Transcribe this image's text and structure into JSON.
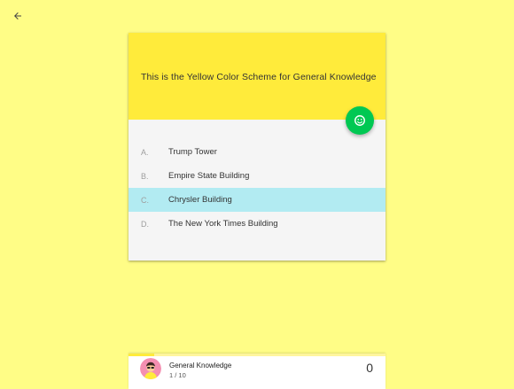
{
  "colors": {
    "background": "#fffd86",
    "header": "#ffeb3b",
    "fab": "#00c853",
    "selected": "#b2ebf2"
  },
  "back_icon": "arrow-left-icon",
  "question": "This is the Yellow Color Scheme for General Knowledge",
  "fab_icon": "smiley-icon",
  "options": [
    {
      "letter": "A.",
      "text": "Trump Tower",
      "selected": false
    },
    {
      "letter": "B.",
      "text": "Empire State Building",
      "selected": false
    },
    {
      "letter": "C.",
      "text": "Chrysler Building",
      "selected": true
    },
    {
      "letter": "D.",
      "text": "The New York Times Building",
      "selected": false
    }
  ],
  "footer": {
    "category": "General Knowledge",
    "progress_text": "1 / 10",
    "progress_fraction": 0.1,
    "score": "0",
    "avatar_icon": "avatar-icon"
  }
}
